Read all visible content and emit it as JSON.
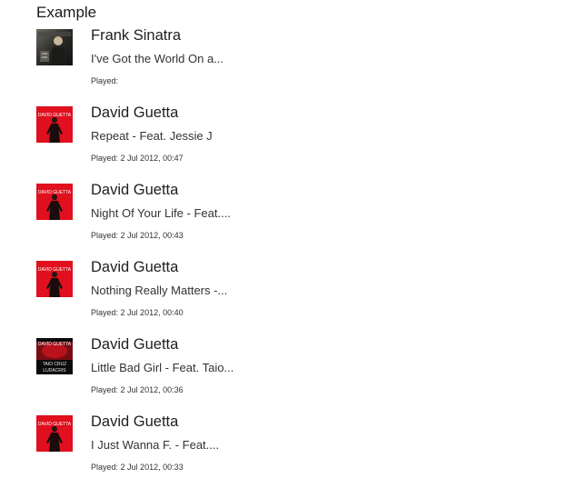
{
  "heading": "Example",
  "played_label": "Played:",
  "tracks": [
    {
      "artist": "Frank Sinatra",
      "title": "I've Got the World On a...",
      "played": "",
      "cover": "sinatra-cover"
    },
    {
      "artist": "David Guetta",
      "title": "Repeat - Feat. Jessie J",
      "played": "2 Jul 2012, 00:47",
      "cover": "guetta-red-cover"
    },
    {
      "artist": "David Guetta",
      "title": "Night Of Your Life - Feat....",
      "played": "2 Jul 2012, 00:43",
      "cover": "guetta-red-cover"
    },
    {
      "artist": "David Guetta",
      "title": "Nothing Really Matters -...",
      "played": "2 Jul 2012, 00:40",
      "cover": "guetta-red-cover"
    },
    {
      "artist": "David Guetta",
      "title": "Little Bad Girl - Feat. Taio...",
      "played": "2 Jul 2012, 00:36",
      "cover": "guetta-little-bad-girl-cover"
    },
    {
      "artist": "David Guetta",
      "title": "I Just Wanna F. - Feat....",
      "played": "2 Jul 2012, 00:33",
      "cover": "guetta-red-cover"
    }
  ],
  "colors": {
    "guetta_red": "#e0101e",
    "sinatra_dark": "#2b2b28"
  },
  "cover_art_text": {
    "guetta_logo": "DAVID GUETTA",
    "little_bad_girl_line1": "TAIO CRUZ",
    "little_bad_girl_line2": "LUDACRIS"
  }
}
